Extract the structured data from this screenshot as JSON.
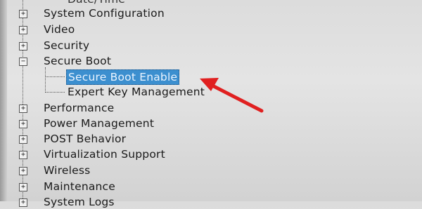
{
  "tree": {
    "items": [
      {
        "label": "Date/Time",
        "expander": ""
      },
      {
        "label": "System Configuration",
        "expander": "+"
      },
      {
        "label": "Video",
        "expander": "+"
      },
      {
        "label": "Security",
        "expander": "+"
      },
      {
        "label": "Secure Boot",
        "expander": "−"
      },
      {
        "label": "Secure Boot Enable",
        "expander": ""
      },
      {
        "label": "Expert Key Management",
        "expander": ""
      },
      {
        "label": "Performance",
        "expander": "+"
      },
      {
        "label": "Power Management",
        "expander": "+"
      },
      {
        "label": "POST Behavior",
        "expander": "+"
      },
      {
        "label": "Virtualization Support",
        "expander": "+"
      },
      {
        "label": "Wireless",
        "expander": "+"
      },
      {
        "label": "Maintenance",
        "expander": "+"
      },
      {
        "label": "System Logs",
        "expander": "+"
      }
    ]
  },
  "colors": {
    "selection": "#3c8fcf",
    "annotation_arrow": "#e02020"
  }
}
